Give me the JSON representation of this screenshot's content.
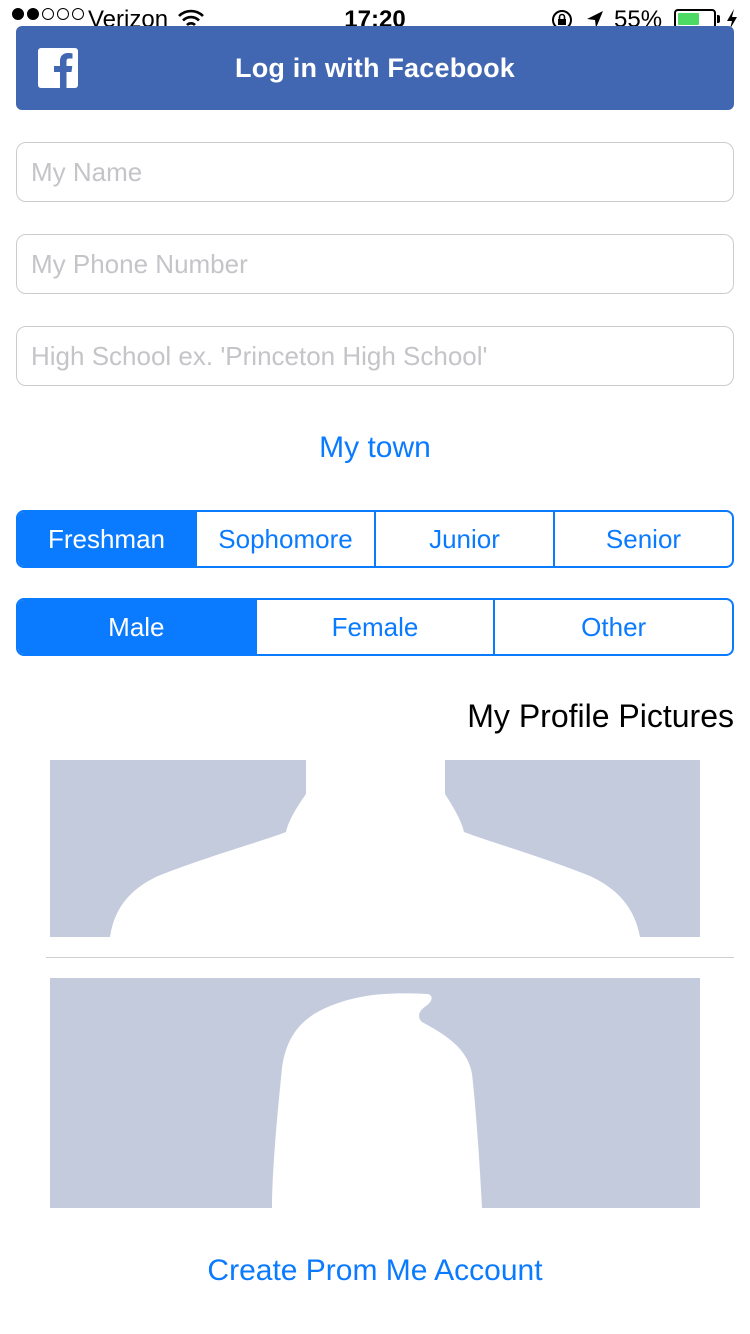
{
  "status_bar": {
    "signal_bars": 5,
    "signal_filled": 2,
    "carrier": "Verizon",
    "time": "17:20",
    "battery_percent": "55%",
    "battery_level": 0.55,
    "icons": [
      "wifi-icon",
      "rotation-lock-icon",
      "location-arrow-icon",
      "battery-icon",
      "charging-bolt-icon"
    ]
  },
  "facebook": {
    "label": "Log in with Facebook",
    "icon": "facebook-logo-icon",
    "color": "#4267b2"
  },
  "form": {
    "name_placeholder": "My Name",
    "phone_placeholder": "My Phone Number",
    "school_placeholder": "High School ex. 'Princeton High School'"
  },
  "town_label": "My town",
  "year_segment": {
    "options": [
      "Freshman",
      "Sophomore",
      "Junior",
      "Senior"
    ],
    "selected": "Freshman"
  },
  "gender_segment": {
    "options": [
      "Male",
      "Female",
      "Other"
    ],
    "selected": "Male"
  },
  "profile_pictures": {
    "title": "My Profile Pictures",
    "placeholder_color": "#c4cbdd"
  },
  "create_account_label": "Create Prom Me Account",
  "accent_color": "#0a7aff"
}
